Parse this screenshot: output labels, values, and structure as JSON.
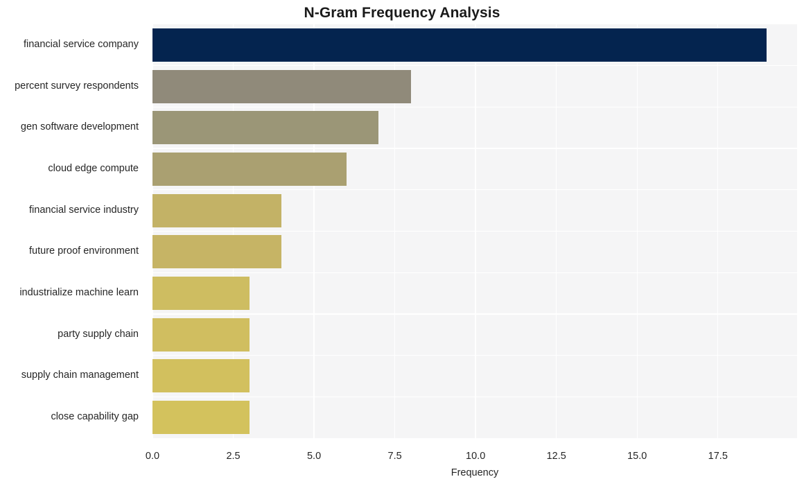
{
  "chart_data": {
    "type": "bar",
    "orientation": "horizontal",
    "title": "N-Gram Frequency Analysis",
    "xlabel": "Frequency",
    "ylabel": "",
    "categories": [
      "financial service company",
      "percent survey respondents",
      "gen software development",
      "cloud edge compute",
      "financial service industry",
      "future proof environment",
      "industrialize machine learn",
      "party supply chain",
      "supply chain management",
      "close capability gap"
    ],
    "values": [
      19,
      8,
      7,
      6,
      4,
      4,
      3,
      3,
      3,
      3
    ],
    "bar_colors": [
      "#04244f",
      "#908a7a",
      "#9b9677",
      "#aaa071",
      "#c3b266",
      "#c6b465",
      "#cebd61",
      "#d0be60",
      "#d2c05e",
      "#d3c25d"
    ],
    "xlim": [
      0,
      19.95
    ],
    "xticks": [
      0.0,
      2.5,
      5.0,
      7.5,
      10.0,
      12.5,
      15.0,
      17.5
    ],
    "xticklabels": [
      "0.0",
      "2.5",
      "5.0",
      "7.5",
      "10.0",
      "12.5",
      "15.0",
      "17.5"
    ],
    "grid": true,
    "grid_color": "#ffffff",
    "plot_background": "#f5f5f6",
    "figure_background": "#ffffff",
    "legend": null
  }
}
